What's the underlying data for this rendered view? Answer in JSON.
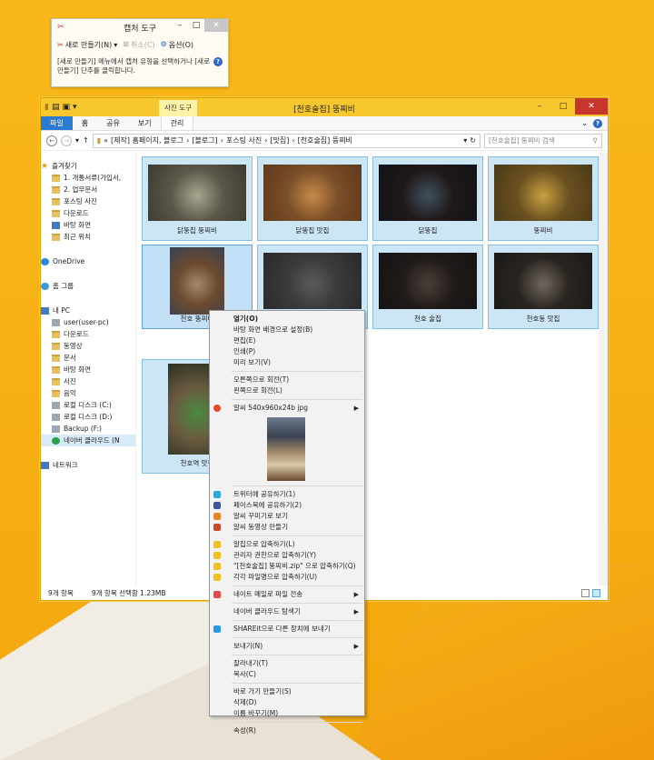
{
  "snip": {
    "title": "캡처 도구",
    "new_label": "새로 만들기(N)",
    "cancel_label": "취소(C)",
    "options_label": "옵션(O)",
    "message": "[새로 만들기] 메뉴에서 캡처 유형을 선택하거나 [새로 만들기] 단추를 클릭합니다."
  },
  "explorer": {
    "title": "[천호술집] 뚱찌비",
    "context_tab": "사진 도구",
    "tabs": [
      "파일",
      "홈",
      "공유",
      "보기",
      "관리"
    ],
    "path": [
      "«",
      "[제작] 홈페이지, 블로그",
      "[블로그]",
      "포스팅 사진",
      "[맛집]",
      "[천호술집] 뚱찌비"
    ],
    "search_placeholder": "[천호술집] 뚱찌비 검색",
    "status_count": "9개 항목",
    "status_selected": "9개 항목 선택함 1.23MB"
  },
  "nav": {
    "favorites": "즐겨찾기",
    "fav_items": [
      "1. 개통서류(가입서,",
      "2. 업무문서",
      "포스팅 사진",
      "다운로드",
      "바탕 화면",
      "최근 위치"
    ],
    "onedrive": "OneDrive",
    "homegroup": "홈 그룹",
    "pc": "내 PC",
    "pc_items": [
      "user(user-pc)",
      "다운로드",
      "동영상",
      "문서",
      "바탕 화면",
      "사진",
      "음악",
      "로컬 디스크 (C:)",
      "로컬 디스크 (D:)",
      "Backup (F:)",
      "네이버 클라우드 (N"
    ],
    "network": "네트워크"
  },
  "files": [
    {
      "label": "닭뚱집 뚱찌비",
      "colors": [
        "#3b3a30",
        "#a8a590",
        "#5a5848"
      ]
    },
    {
      "label": "닭뚱집 맛집",
      "colors": [
        "#5e3a1e",
        "#c88a4a",
        "#7a4e28"
      ]
    },
    {
      "label": "닭뚱집",
      "colors": [
        "#101418",
        "#405060",
        "#201818"
      ]
    },
    {
      "label": "뚱찌비",
      "colors": [
        "#4a3a18",
        "#c8a040",
        "#6a5020"
      ]
    },
    {
      "label": "천호 뚱찌비",
      "colors": [
        "#3a4250",
        "#a38a6a",
        "#6b4a30"
      ]
    },
    {
      "label": "",
      "colors": [
        "#2a2a2a",
        "#5a5a5a",
        "#3a3a3a"
      ]
    },
    {
      "label": "천호 술집",
      "colors": [
        "#141414",
        "#4a4038",
        "#201a18"
      ]
    },
    {
      "label": "천호동 맛집",
      "colors": [
        "#1a1a1a",
        "#706860",
        "#2a2420"
      ]
    },
    {
      "label": "천호역 맛집",
      "colors": [
        "#2a3020",
        "#4a8a40",
        "#6a5a40"
      ]
    }
  ],
  "menu": {
    "open": "열기(O)",
    "group1": [
      "바탕 화면 배경으로 설정(B)",
      "편집(E)",
      "인쇄(P)",
      "미리 보기(V)"
    ],
    "rotate": [
      "오른쪽으로 회전(T)",
      "왼쪽으로 회전(L)"
    ],
    "alsee": "알씨 540x960x24b jpg",
    "share": [
      "트위터에 공유하기(1)",
      "페이스북에 공유하기(2)",
      "알씨 꾸미기로 보기",
      "알씨 동영상 만들기"
    ],
    "zip": [
      "알집으로 압축하기(L)",
      "관리자 권한으로 압축하기(Y)",
      "\"[천호술집] 뚱찌비.zip\" 으로 압축하기(Q)",
      "각각 파일명으로 압축하기(U)"
    ],
    "nate": "네이트 메일로 파일 전송",
    "naver": "네이버 클라우드 탐색기",
    "shareit": "SHAREit으로 다른 장치에 보내기",
    "sendto": "보내기(N)",
    "edit": [
      "잘라내기(T)",
      "복사(C)"
    ],
    "manage": [
      "바로 가기 만들기(S)",
      "삭제(D)",
      "이름 바꾸기(M)"
    ],
    "props": "속성(R)"
  }
}
